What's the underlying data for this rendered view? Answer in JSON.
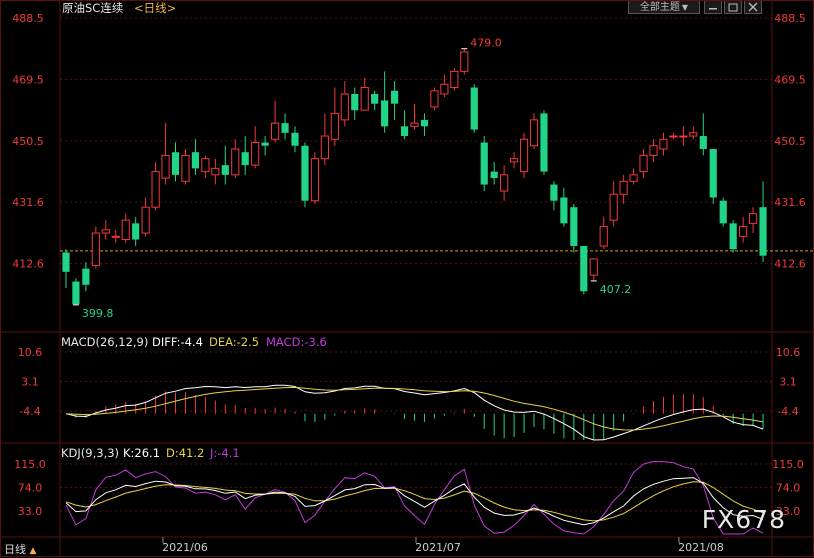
{
  "window": {
    "title": "原油SC连续",
    "period": "<日线>",
    "theme_button": "全部主题",
    "theme_button_arrow": "▼",
    "period_tab": "日线",
    "period_tab_arrow": "▲",
    "watermark": "FX678"
  },
  "colors": {
    "up": "#f03a3a",
    "down": "#22d488",
    "price_label": "#f03a3a",
    "diff": "#ffffff",
    "dea": "#e6d24a",
    "macd": "#c03cd8",
    "k": "#ffffff",
    "d": "#e6d24a",
    "j": "#c03cd8",
    "ref_line": "#d89a20",
    "grid": "#5a1010"
  },
  "chart_data": [
    {
      "type": "candlestick",
      "title": "原油SC连续",
      "y_ticks": [
        "488.5",
        "469.5",
        "450.5",
        "431.6",
        "412.6"
      ],
      "ylim": [
        397,
        490
      ],
      "annotations": [
        {
          "text": "479.0",
          "value": 479.0
        },
        {
          "text": "399.8",
          "value": 399.8
        },
        {
          "text": "407.2",
          "value": 407.2
        }
      ],
      "ref_value": 416.5,
      "candles": [
        [
          416,
          410,
          417,
          405
        ],
        [
          407,
          400,
          408,
          399.8
        ],
        [
          411,
          406,
          413,
          404
        ],
        [
          412,
          422,
          424,
          411
        ],
        [
          422,
          423,
          426,
          420
        ],
        [
          421,
          421,
          423,
          419
        ],
        [
          420,
          426,
          428,
          419
        ],
        [
          425,
          420,
          427,
          418
        ],
        [
          422,
          430,
          433,
          421
        ],
        [
          430,
          441,
          444,
          429
        ],
        [
          439,
          446,
          456,
          437
        ],
        [
          447,
          440,
          450,
          438
        ],
        [
          438,
          446,
          448,
          437
        ],
        [
          447,
          442,
          451,
          440
        ],
        [
          441,
          445,
          446,
          439
        ],
        [
          440,
          442,
          445,
          437
        ],
        [
          443,
          440,
          449,
          437
        ],
        [
          440,
          448,
          451,
          439
        ],
        [
          447,
          443,
          452,
          440
        ],
        [
          443,
          450,
          455,
          442
        ],
        [
          450,
          449,
          452,
          446
        ],
        [
          451,
          456,
          463,
          450
        ],
        [
          456,
          453,
          459,
          451
        ],
        [
          453,
          449,
          455,
          447
        ],
        [
          449,
          432,
          450,
          430
        ],
        [
          432,
          445,
          447,
          431
        ],
        [
          445,
          452,
          459,
          443
        ],
        [
          451,
          459,
          467,
          449
        ],
        [
          457,
          465,
          469,
          455
        ],
        [
          465,
          460,
          467,
          457
        ],
        [
          460,
          467,
          470,
          460
        ],
        [
          465,
          462,
          466,
          460
        ],
        [
          463,
          455,
          472,
          453
        ],
        [
          466,
          462,
          469,
          457
        ],
        [
          455,
          452,
          460,
          451
        ],
        [
          455,
          456,
          462,
          454
        ],
        [
          457,
          455,
          459,
          452
        ],
        [
          461,
          466,
          467,
          460
        ],
        [
          465,
          468,
          471,
          464
        ],
        [
          467,
          472,
          473,
          466
        ],
        [
          472,
          478,
          479,
          471
        ],
        [
          467,
          454,
          468,
          453
        ],
        [
          450,
          437,
          452,
          435
        ],
        [
          441,
          439,
          444,
          437
        ],
        [
          435,
          440,
          443,
          432
        ],
        [
          444,
          445,
          447,
          442
        ],
        [
          441,
          451,
          453,
          439
        ],
        [
          449,
          457,
          459,
          448
        ],
        [
          459,
          441,
          460,
          440
        ],
        [
          437,
          432,
          438,
          429
        ],
        [
          433,
          425,
          436,
          424
        ],
        [
          430,
          418,
          431,
          416
        ],
        [
          418,
          404,
          418,
          403
        ],
        [
          409,
          414,
          414,
          407.2
        ],
        [
          418,
          424,
          427,
          417
        ],
        [
          426,
          434,
          438,
          424
        ],
        [
          434,
          438,
          440,
          431
        ],
        [
          438,
          440,
          442,
          437
        ],
        [
          441,
          446,
          448,
          439
        ],
        [
          446,
          449,
          451,
          444
        ],
        [
          448,
          451,
          453,
          446
        ],
        [
          452,
          452,
          453,
          451
        ],
        [
          452,
          452,
          455,
          449
        ],
        [
          452,
          453,
          455,
          451
        ],
        [
          452,
          448,
          459,
          446
        ],
        [
          448,
          433,
          448,
          431
        ],
        [
          432,
          425,
          433,
          424
        ],
        [
          425,
          417,
          426,
          416
        ],
        [
          421,
          424,
          427,
          419
        ],
        [
          425,
          428,
          430,
          422
        ],
        [
          430,
          415,
          438,
          413
        ]
      ]
    },
    {
      "type": "line",
      "title": "MACD(26,12,9)",
      "series": [
        {
          "name": "DIFF",
          "current": "-4.4"
        },
        {
          "name": "DEA",
          "current": "-2.5"
        },
        {
          "name": "MACD",
          "current": "-3.6"
        }
      ],
      "y_ticks": [
        "10.6",
        "3.1",
        "-4.4"
      ],
      "ylim": [
        -12,
        13
      ]
    },
    {
      "type": "line",
      "title": "KDJ(9,3,3)",
      "series": [
        {
          "name": "K",
          "current": "26.1"
        },
        {
          "name": "D",
          "current": "41.2"
        },
        {
          "name": "J",
          "current": "-4.1"
        }
      ],
      "y_ticks": [
        "115.0",
        "74.0",
        "33.0"
      ],
      "ylim": [
        -10,
        125
      ]
    }
  ],
  "x_ticks": [
    "2021/06",
    "2021/07",
    "2021/08"
  ]
}
